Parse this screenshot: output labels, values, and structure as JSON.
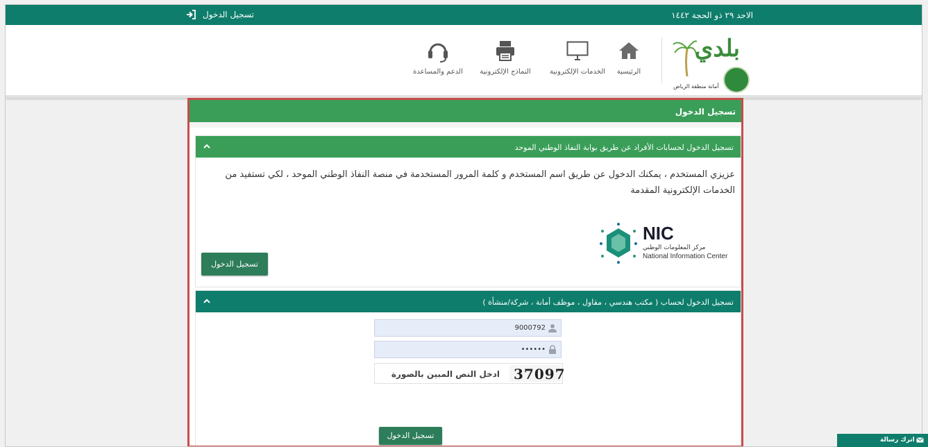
{
  "topbar": {
    "date": "الاحد ٢٩ ذو الحجة ١٤٤٢",
    "login_label": "تسجيل الدخول",
    "login_icon": "sign-in-icon"
  },
  "logo": {
    "brand": "بلدي",
    "subtitle": "أمانة منطقة الرياض"
  },
  "nav": [
    {
      "label": "الرئيسية",
      "icon": "home-icon"
    },
    {
      "label": "الخدمات الإلكترونية",
      "icon": "monitor-icon"
    },
    {
      "label": "النماذج الإلكترونية",
      "icon": "printer-icon"
    },
    {
      "label": "الدعم والمساعدة",
      "icon": "headset-icon"
    }
  ],
  "panel": {
    "title": "تسجيل الدخول",
    "section1": {
      "title": "تسجيل الدخول لحسابات الأفراد عن طريق بوابة النفاذ الوطني الموحد",
      "intro": "عزيزي المستخدم ، يمكنك الدخول عن طريق اسم المستخدم و كلمة المرور المستخدمة في منصة النفاذ الوطني الموحد ، لكي تستفيد من الخدمات الإلكترونية المقدمة",
      "nic_title": "NIC",
      "nic_ar": "مركز المعلومات الوطني",
      "nic_en": "National Information Center",
      "button": "تسجيل الدخول"
    },
    "section2": {
      "title": "تسجيل الدخول لحساب ( مكتب هندسي ، مقاول ، موظف أمانة ، شركة/منشأة )",
      "username_value": "9000792",
      "password_value": "••••••",
      "captcha_placeholder": "ادخل النص المبين بالصورة",
      "captcha_text": "37097",
      "button": "تسجيل الدخول"
    }
  },
  "message_button": {
    "label": "اترك رسالة",
    "icon": "envelope-icon"
  },
  "colors": {
    "primary": "#0e7d6c",
    "green": "#3a9e58",
    "highlight": "#c94b4b"
  }
}
